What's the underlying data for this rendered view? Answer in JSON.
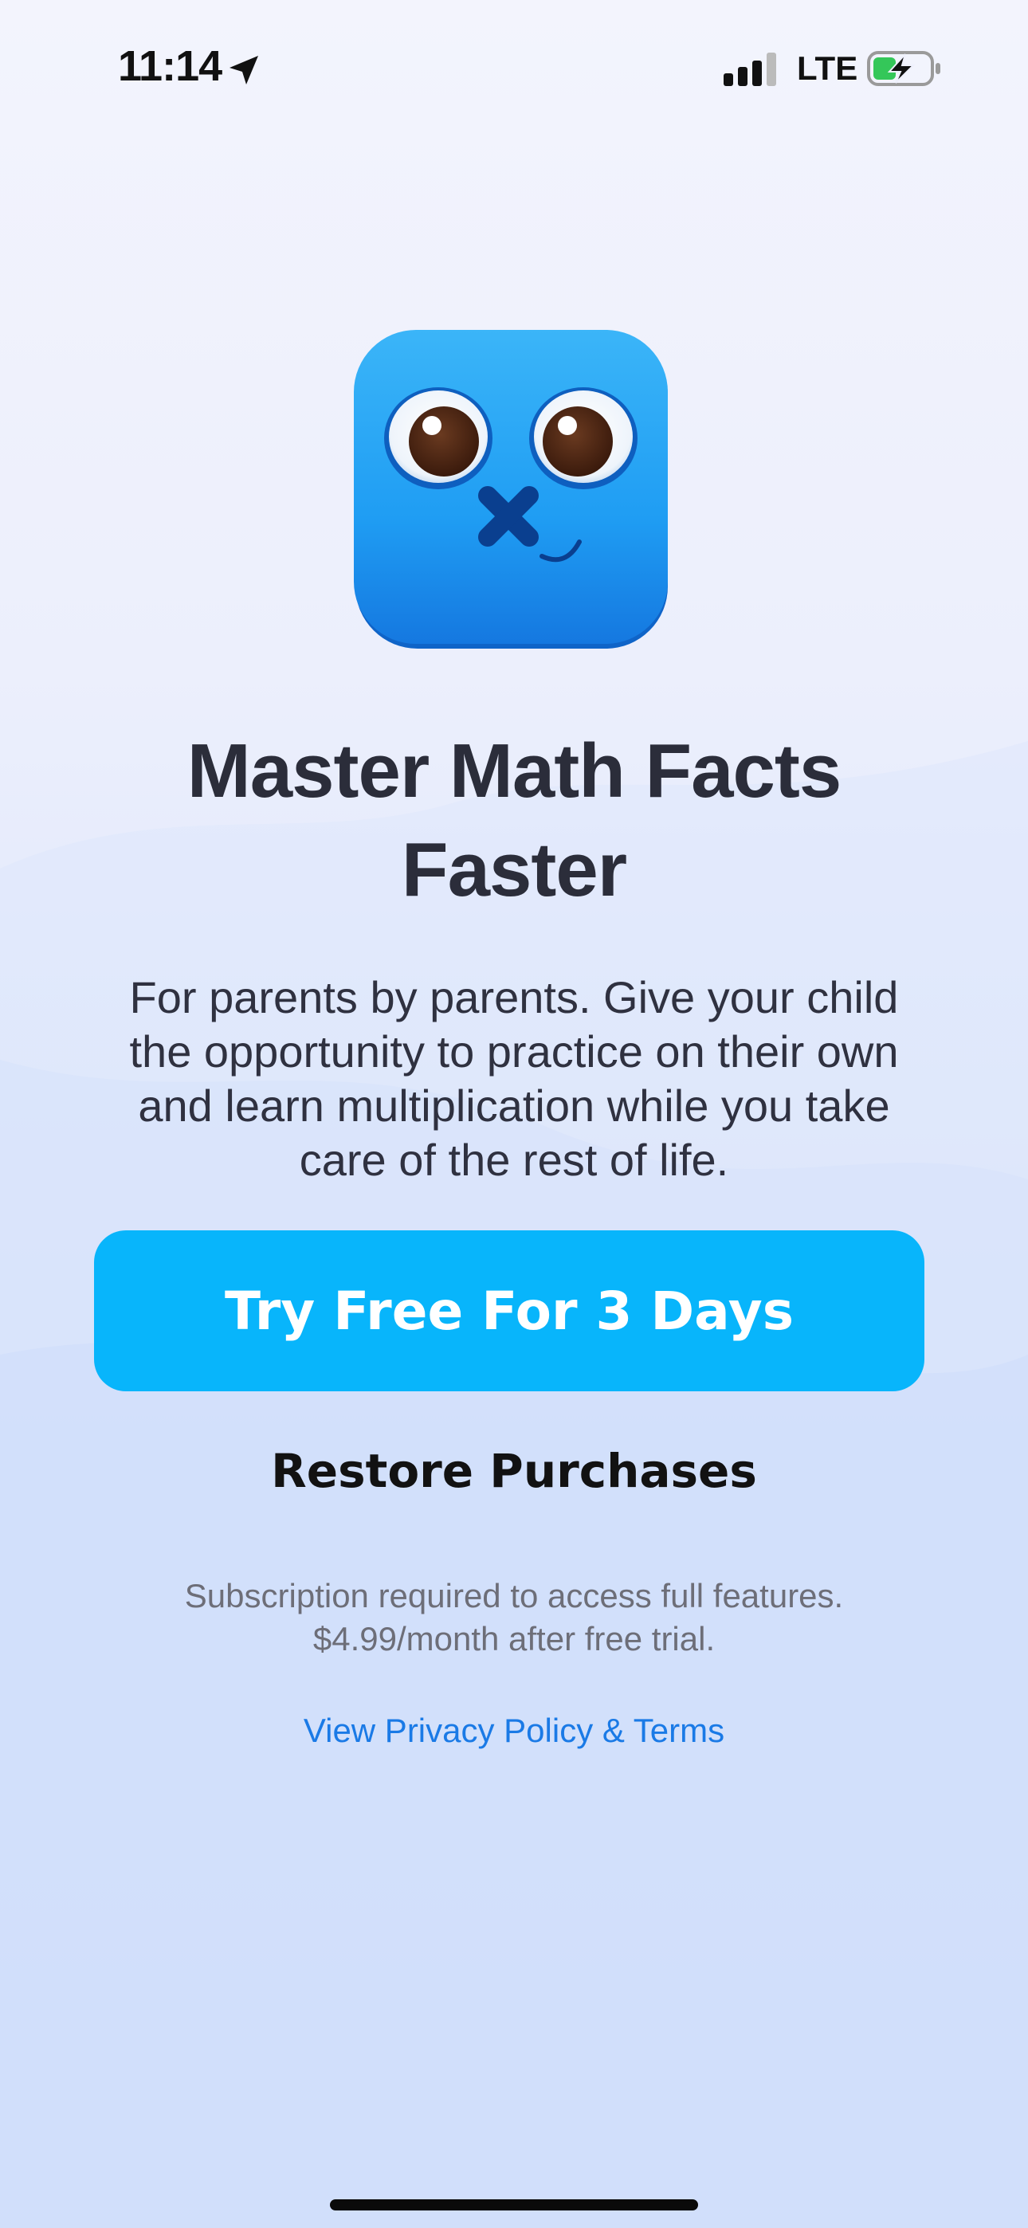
{
  "status_bar": {
    "time": "11:14",
    "network": "LTE"
  },
  "paywall": {
    "title_line1": "Master Math Facts",
    "title_line2": "Faster",
    "description_line1": "For parents by parents. Give your child",
    "description_line2": "the opportunity to practice on their own",
    "description_line3": "and learn multiplication while you take",
    "description_line4": "care of the rest of life.",
    "cta_label": "Try Free For 3 Days",
    "restore_label": "Restore Purchases",
    "note_line1": "Subscription required to access full features.",
    "note_line2": "$4.99/month after free trial.",
    "privacy_link_label": "View Privacy Policy & Terms"
  },
  "colors": {
    "cta_background": "#08b5fb",
    "link": "#1a7ae6",
    "title": "#2b2d3a",
    "app_icon_blue": "#1e9df4"
  },
  "icons": {
    "location": "location-arrow-icon",
    "signal": "cellular-signal-icon",
    "battery": "battery-charging-icon",
    "app": "app-icon-face"
  }
}
